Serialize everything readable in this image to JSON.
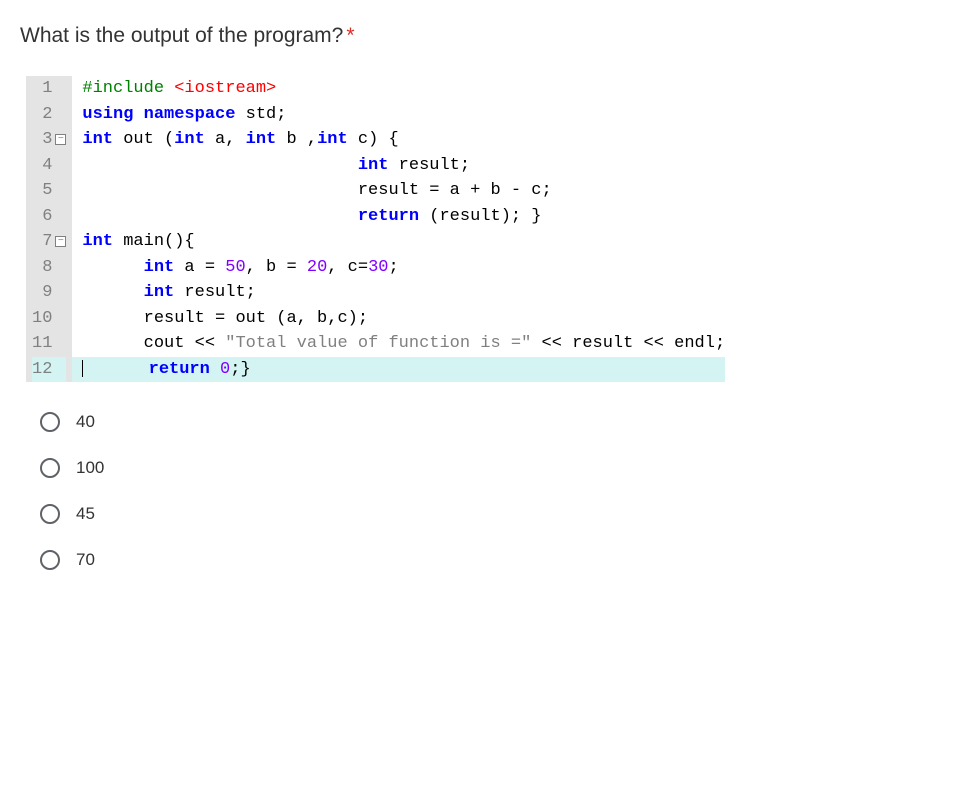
{
  "question": "What is the output of the program?",
  "required_mark": "*",
  "gutter_lines": [
    "1",
    "2",
    "3",
    "4",
    "5",
    "6",
    "7",
    "8",
    "9",
    "10",
    "11",
    "12"
  ],
  "code": {
    "l1_pre": "#include ",
    "l1_ang": "<iostream>",
    "l2_a": "using ",
    "l2_b": "namespace",
    "l2_c": " std;",
    "l3_a": "int",
    "l3_b": " out (",
    "l3_c": "int",
    "l3_d": " a, ",
    "l3_e": "int",
    "l3_f": " b ,",
    "l3_g": "int",
    "l3_h": " c) {",
    "l4_pad": "                           ",
    "l4_a": "int",
    "l4_b": " result;",
    "l5_pad": "                           ",
    "l5_txt": "result = a + b - c;",
    "l6_pad": "                           ",
    "l6_a": "return",
    "l6_b": " (result); }",
    "l7_a": "int",
    "l7_b": " main(){",
    "l8_pad": "      ",
    "l8_a": "int",
    "l8_b": " a = ",
    "l8_c": "50",
    "l8_d": ", b = ",
    "l8_e": "20",
    "l8_f": ", c=",
    "l8_g": "30",
    "l8_h": ";",
    "l9_pad": "      ",
    "l9_a": "int",
    "l9_b": " result;",
    "l10_pad": "      ",
    "l10_txt": "result = out (a, b,c);",
    "l11_pad": "      ",
    "l11_a": "cout << ",
    "l11_str": "\"Total value of function is =\"",
    "l11_b": " << result << endl;",
    "l12_pad": "      ",
    "l12_a": "return",
    "l12_b": " ",
    "l12_c": "0",
    "l12_d": ";}"
  },
  "options": [
    "40",
    "100",
    "45",
    "70"
  ]
}
